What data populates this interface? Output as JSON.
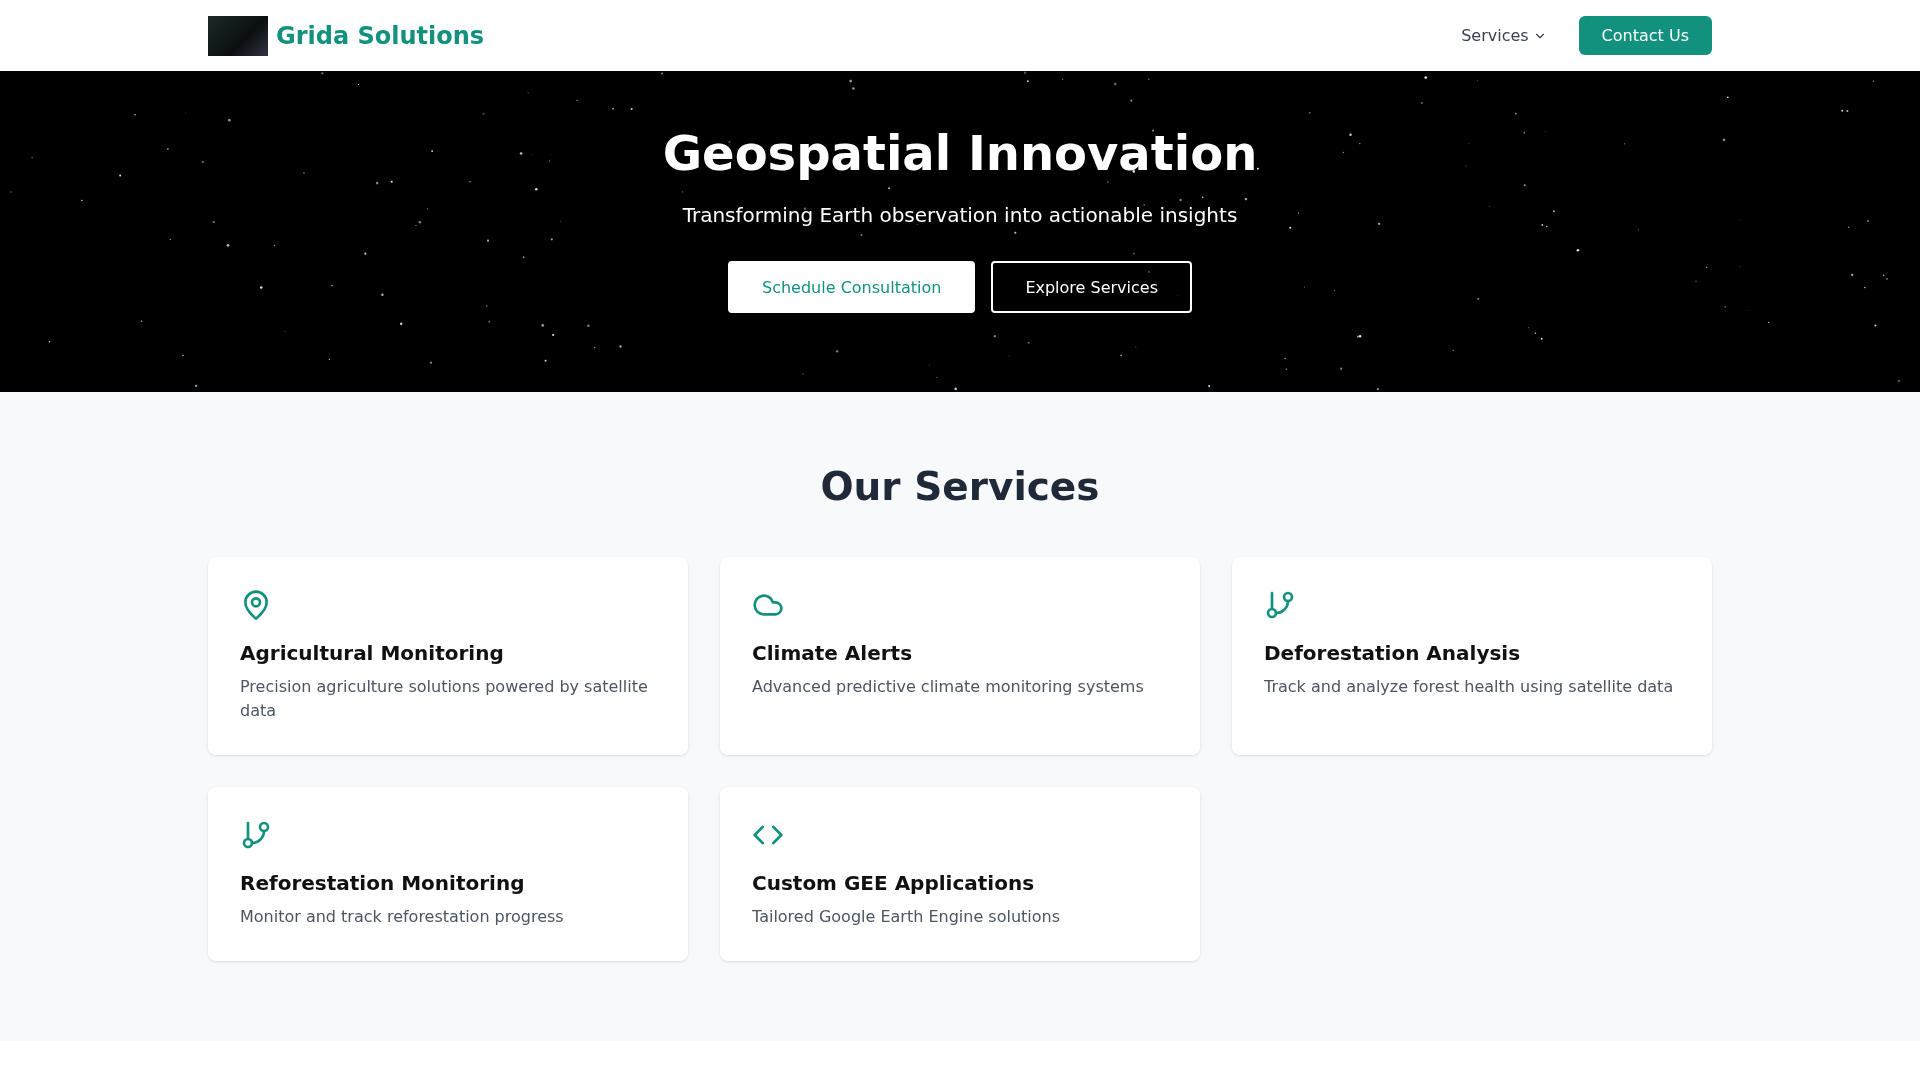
{
  "header": {
    "brand": "Grida Solutions",
    "nav": [
      {
        "label": "Services",
        "kind": "dropdown"
      },
      {
        "label": "Contact Us",
        "kind": "button"
      }
    ]
  },
  "hero": {
    "title": "Geospatial Innovation",
    "subtitle": "Transforming Earth observation into actionable insights",
    "buttons": [
      {
        "label": "Schedule Consultation",
        "kind": "primary"
      },
      {
        "label": "Explore Services",
        "kind": "outline"
      }
    ]
  },
  "services": {
    "title": "Our Services",
    "cards": [
      {
        "kind": "pin",
        "title": "Agricultural Monitoring",
        "description": "Precision agriculture solutions powered by satellite data"
      },
      {
        "kind": "cloud",
        "title": "Climate Alerts",
        "description": "Advanced predictive climate monitoring systems"
      },
      {
        "kind": "branch",
        "title": "Deforestation Analysis",
        "description": "Track and analyze forest health using satellite data"
      },
      {
        "kind": "branch",
        "title": "Reforestation Monitoring",
        "description": "Monitor and track reforestation progress"
      },
      {
        "kind": "code",
        "title": "Custom GEE Applications",
        "description": "Tailored Google Earth Engine solutions"
      }
    ]
  }
}
